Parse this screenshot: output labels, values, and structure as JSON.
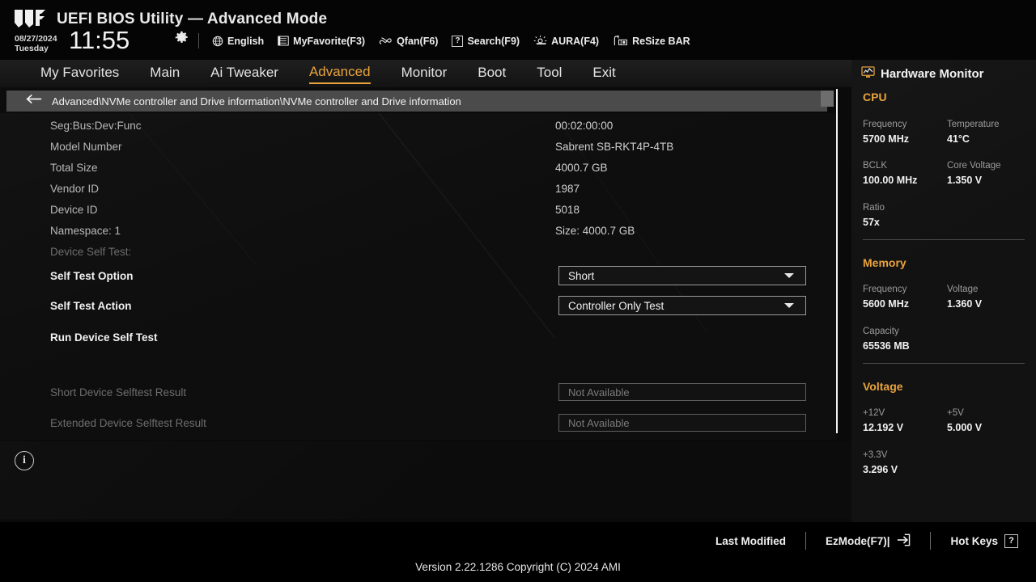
{
  "header": {
    "title": "UEFI BIOS Utility — Advanced Mode",
    "date": "08/27/2024",
    "weekday": "Tuesday",
    "time": "11:55",
    "gear_icon": "gear-icon",
    "items": [
      {
        "label": "English",
        "icon": "globe-icon"
      },
      {
        "label": "MyFavorite(F3)",
        "icon": "list-icon"
      },
      {
        "label": "Qfan(F6)",
        "icon": "fan-icon"
      },
      {
        "label": "Search(F9)",
        "icon": "question-box-icon"
      },
      {
        "label": "AURA(F4)",
        "icon": "aura-light-icon"
      },
      {
        "label": "ReSize BAR",
        "icon": "resize-bar-icon"
      }
    ]
  },
  "nav": {
    "items": [
      {
        "label": "My Favorites",
        "active": false
      },
      {
        "label": "Main",
        "active": false
      },
      {
        "label": "Ai Tweaker",
        "active": false
      },
      {
        "label": "Advanced",
        "active": true
      },
      {
        "label": "Monitor",
        "active": false
      },
      {
        "label": "Boot",
        "active": false
      },
      {
        "label": "Tool",
        "active": false
      },
      {
        "label": "Exit",
        "active": false
      }
    ],
    "accent_color": "#e8a33d"
  },
  "breadcrumb": {
    "back_icon": "back-arrow-icon",
    "path": "Advanced\\NVMe controller and Drive information\\NVMe controller and Drive information"
  },
  "content": {
    "info_rows": [
      {
        "label": "Seg:Bus:Dev:Func",
        "value": "00:02:00:00"
      },
      {
        "label": "Model Number",
        "value": "Sabrent SB-RKT4P-4TB"
      },
      {
        "label": "Total Size",
        "value": "4000.7 GB"
      },
      {
        "label": "Vendor ID",
        "value": "1987"
      },
      {
        "label": "Device ID",
        "value": "5018"
      },
      {
        "label": "Namespace: 1",
        "value": "Size: 4000.7 GB"
      }
    ],
    "self_test_header": "Device Self Test:",
    "self_test_option_label": "Self Test Option",
    "self_test_option_value": "Short",
    "self_test_action_label": "Self Test Action",
    "self_test_action_value": "Controller Only Test",
    "run_self_test_label": "Run Device Self Test",
    "short_result_label": "Short Device Selftest Result",
    "short_result_value": "Not Available",
    "extended_result_label": "Extended Device Selftest Result",
    "extended_result_value": "Not Available"
  },
  "info_panel": {
    "icon": "info-circle-icon",
    "glyph": "i"
  },
  "hardware_monitor": {
    "title": "Hardware Monitor",
    "title_icon": "monitor-icon",
    "sections": [
      {
        "name": "CPU",
        "metrics": [
          {
            "key": "Frequency",
            "value": "5700 MHz"
          },
          {
            "key": "Temperature",
            "value": "41°C"
          },
          {
            "key": "BCLK",
            "value": "100.00 MHz"
          },
          {
            "key": "Core Voltage",
            "value": "1.350 V"
          },
          {
            "key": "Ratio",
            "value": "57x"
          }
        ]
      },
      {
        "name": "Memory",
        "metrics": [
          {
            "key": "Frequency",
            "value": "5600 MHz"
          },
          {
            "key": "Voltage",
            "value": "1.360 V"
          },
          {
            "key": "Capacity",
            "value": "65536 MB"
          }
        ]
      },
      {
        "name": "Voltage",
        "metrics": [
          {
            "key": "+12V",
            "value": "12.192 V"
          },
          {
            "key": "+5V",
            "value": "5.000 V"
          },
          {
            "key": "+3.3V",
            "value": "3.296 V"
          }
        ]
      }
    ]
  },
  "footer": {
    "last_modified": "Last Modified",
    "ez_mode": "EzMode(F7)|",
    "ez_mode_icon": "exit-arrow-icon",
    "hot_keys": "Hot Keys",
    "hot_keys_glyph": "?",
    "version": "Version 2.22.1286 Copyright (C) 2024 AMI"
  }
}
